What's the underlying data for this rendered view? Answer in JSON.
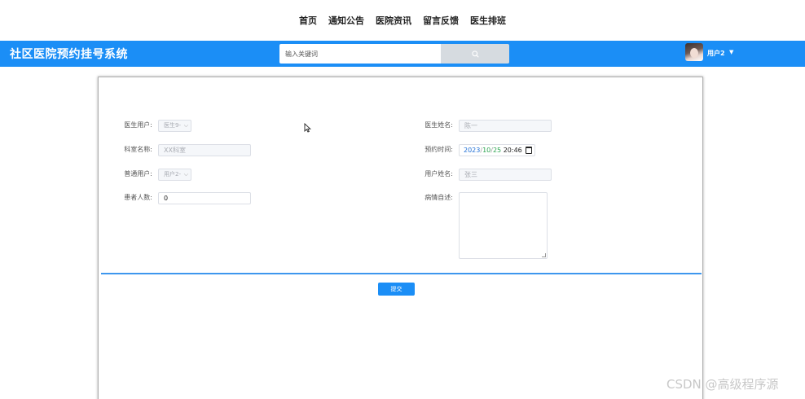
{
  "topnav": {
    "items": [
      {
        "label": "首页"
      },
      {
        "label": "通知公告"
      },
      {
        "label": "医院资讯"
      },
      {
        "label": "留言反馈"
      },
      {
        "label": "医生排班"
      }
    ]
  },
  "header": {
    "title": "社区医院预约挂号系统",
    "search_placeholder": "输入关键词",
    "search_icon": "search-icon",
    "user_name": "用户2",
    "caret_icon": "caret-down-icon",
    "color": "#1b8ef6"
  },
  "form": {
    "doctor_user": {
      "label": "医生用户:",
      "value": "医生9-"
    },
    "doctor_name": {
      "label": "医生姓名:",
      "value": "陈一"
    },
    "dept_name": {
      "label": "科室名称:",
      "value": "XX科室"
    },
    "appointment_time": {
      "label": "预约时间:",
      "year": "2023",
      "month": "10",
      "day": "25",
      "time": "20:46",
      "icon": "calendar-icon"
    },
    "normal_user": {
      "label": "普通用户:",
      "value": "用户2-"
    },
    "user_name": {
      "label": "用户姓名:",
      "value": "张三"
    },
    "patient_count": {
      "label": "患者人数:",
      "value": "0"
    },
    "condition": {
      "label": "病情自述:",
      "value": ""
    },
    "submit_label": "提交"
  },
  "watermark": "CSDN @高级程序源"
}
